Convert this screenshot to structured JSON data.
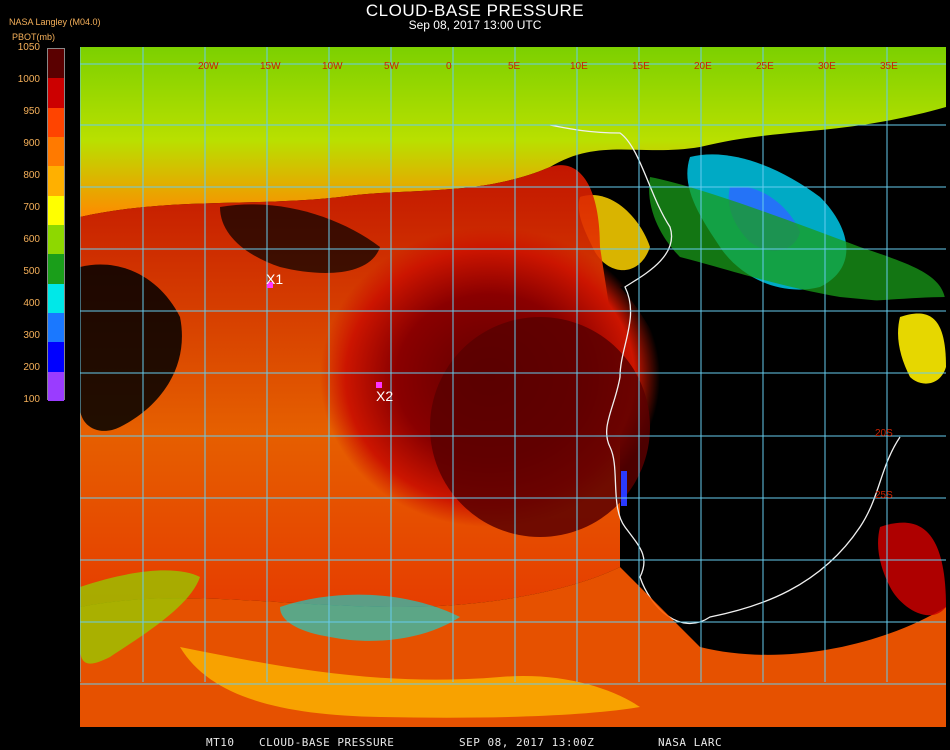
{
  "title": "CLOUD-BASE PRESSURE",
  "subtitle": "Sep 08, 2017 13:00 UTC",
  "source_label": "NASA Langley (M04.0)",
  "param_label": "PBOT(mb)",
  "legend": {
    "ticks": [
      "1050",
      "1000",
      "950",
      "900",
      "800",
      "700",
      "600",
      "500",
      "400",
      "300",
      "200",
      "100"
    ],
    "colors": [
      "#5a0000",
      "#cc0000",
      "#ff4400",
      "#ff7a00",
      "#ffb000",
      "#ffff00",
      "#8ed800",
      "#1a9e1a",
      "#00e8e8",
      "#1a78ff",
      "#0000ff",
      "#9a3cff"
    ]
  },
  "map": {
    "lat_labels": [
      "20S",
      "25S"
    ],
    "lon_labels": [
      "20W",
      "15W",
      "10W",
      "5W",
      "0",
      "5E",
      "10E",
      "15E",
      "20E",
      "25E",
      "30E",
      "35E"
    ],
    "markers": [
      {
        "label": "X1"
      },
      {
        "label": "X2"
      }
    ],
    "gridline_color": "#66ccee"
  },
  "footer": {
    "satellite": "MT10",
    "product": "CLOUD-BASE PRESSURE",
    "datetime": "SEP 08, 2017 13:00Z",
    "org": "NASA LARC"
  }
}
